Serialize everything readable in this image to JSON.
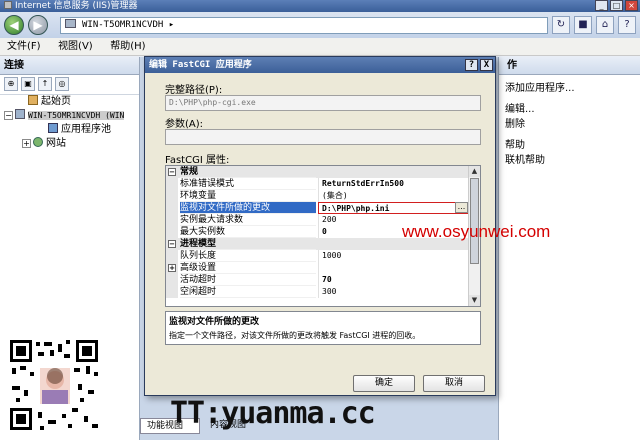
{
  "window": {
    "title": "Internet 信息服务 (IIS)管理器",
    "controls": [
      "_",
      "□",
      "×"
    ]
  },
  "address": {
    "path": "WIN-T5OMR1NCVDH  ▸"
  },
  "menu": {
    "items": [
      "文件(F)",
      "视图(V)",
      "帮助(H)"
    ]
  },
  "connections": {
    "header": "连接",
    "tree": [
      {
        "label": "起始页"
      },
      {
        "label": "WIN-T5OMR1NCVDH (WIN",
        "expander": "−"
      },
      {
        "label": "应用程序池"
      },
      {
        "label": "网站",
        "expander": "+"
      }
    ]
  },
  "actions": {
    "header": "作",
    "items": [
      "添加应用程序...",
      "编辑...",
      "删除",
      "帮助",
      "联机帮助"
    ]
  },
  "dialog": {
    "title": "编辑 FastCGI 应用程序",
    "controls": [
      "?",
      "X"
    ],
    "path_label": "完整路径(P):",
    "path_value": "D:\\PHP\\php-cgi.exe",
    "args_label": "参数(A):",
    "args_value": "",
    "props_label": "FastCGI 属性:",
    "rows": [
      {
        "type": "cat",
        "expander": "−",
        "name": "常规"
      },
      {
        "name": "标准错误模式",
        "value": "ReturnStdErrIn500",
        "bold": true
      },
      {
        "name": "环境变量",
        "value": "(集合)"
      },
      {
        "name": "监视对文件所做的更改",
        "value": "D:\\PHP\\php.ini",
        "selected": true
      },
      {
        "name": "实例最大请求数",
        "value": "200"
      },
      {
        "name": "最大实例数",
        "value": "0",
        "bold": true
      },
      {
        "type": "cat",
        "expander": "−",
        "name": "进程模型"
      },
      {
        "name": "队列长度",
        "value": "1000"
      },
      {
        "name": "高级设置",
        "expander": "+"
      },
      {
        "name": "活动超时",
        "value": "70",
        "bold": true
      },
      {
        "name": "空闲超时",
        "value": "300"
      }
    ],
    "edit_button": "...",
    "desc_title": "监视对文件所做的更改",
    "desc_text": "指定一个文件路径，对该文件所做的更改将触发 FastCGI 进程的回收。",
    "ok_label": "确定",
    "cancel_label": "取消"
  },
  "bottom_tabs": [
    "功能视图",
    "内容视图"
  ],
  "watermarks": {
    "url": "www.osyunwei.com",
    "tt": "TT:yuanma.cc"
  }
}
